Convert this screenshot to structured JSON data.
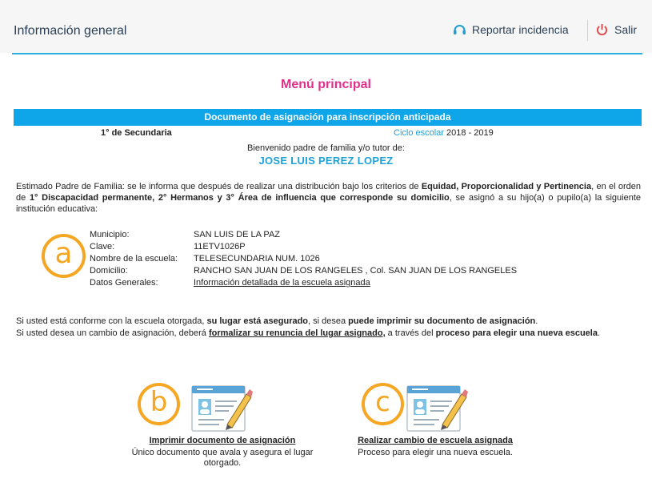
{
  "header": {
    "title": "Información general",
    "report_label": "Reportar incidencia",
    "logout_label": "Salir"
  },
  "main": {
    "menu_title": "Menú principal",
    "doc_title": "Documento de asignación para inscripción anticipada",
    "grade": "1° de Secundaria",
    "cycle_label": "Ciclo escolar",
    "cycle_value": "2018 - 2019",
    "welcome": "Bienvenido padre de familia y/o tutor de:",
    "student_name": "JOSE LUIS PEREZ LOPEZ",
    "intro": {
      "p1": "Estimado Padre de Familia: se le informa que después de realizar una distribución bajo los criterios de ",
      "b1": "Equidad, Proporcionalidad y Pertinencia",
      "p2": ", en el orden de ",
      "b2": "1° Discapacidad permanente, 2° Hermanos y 3° Área de influencia que corresponde su domicilio",
      "p3": ", se asignó a su hijo(a) o pupilo(a) la siguiente institución educativa:"
    },
    "school": {
      "municipio_label": "Municipio:",
      "municipio": "SAN LUIS DE LA PAZ",
      "clave_label": "Clave:",
      "clave": "11ETV1026P",
      "nombre_label": "Nombre de la escuela:",
      "nombre": "TELESECUNDARIA NUM. 1026",
      "domicilio_label": "Domicilio:",
      "domicilio": "RANCHO SAN JUAN DE LOS RANGELES , Col. SAN JUAN DE LOS RANGELES",
      "datos_label": "Datos Generales:",
      "datos_link": "Información detallada de la escuela asignada"
    },
    "conform": {
      "p1": "Si usted está conforme con la escuela otorgada, ",
      "b1": "su lugar está asegurado",
      "p2": ", si desea ",
      "b2": "puede imprimir su documento de asignación",
      "p3": ".",
      "p4": "Si usted desea un cambio de asignación, deberá ",
      "u1": "formalizar su renuncia del lugar asignado,",
      "p5": " a través del ",
      "b3": "proceso para elegir una nueva escuela",
      "p6": "."
    },
    "markers": {
      "a": "a",
      "b": "b",
      "c": "c"
    },
    "print_action": {
      "title": "Imprimir documento de asignación",
      "desc": "Único documento que avala y asegura el lugar otorgado."
    },
    "change_action": {
      "title": "Realizar cambio de escuela asignada",
      "desc": "Proceso para elegir una nueva escuela."
    }
  },
  "colors": {
    "accent_blue": "#0ea5e9",
    "magenta": "#e0308a",
    "orange": "#f5a623",
    "logout_red": "#e05050"
  }
}
